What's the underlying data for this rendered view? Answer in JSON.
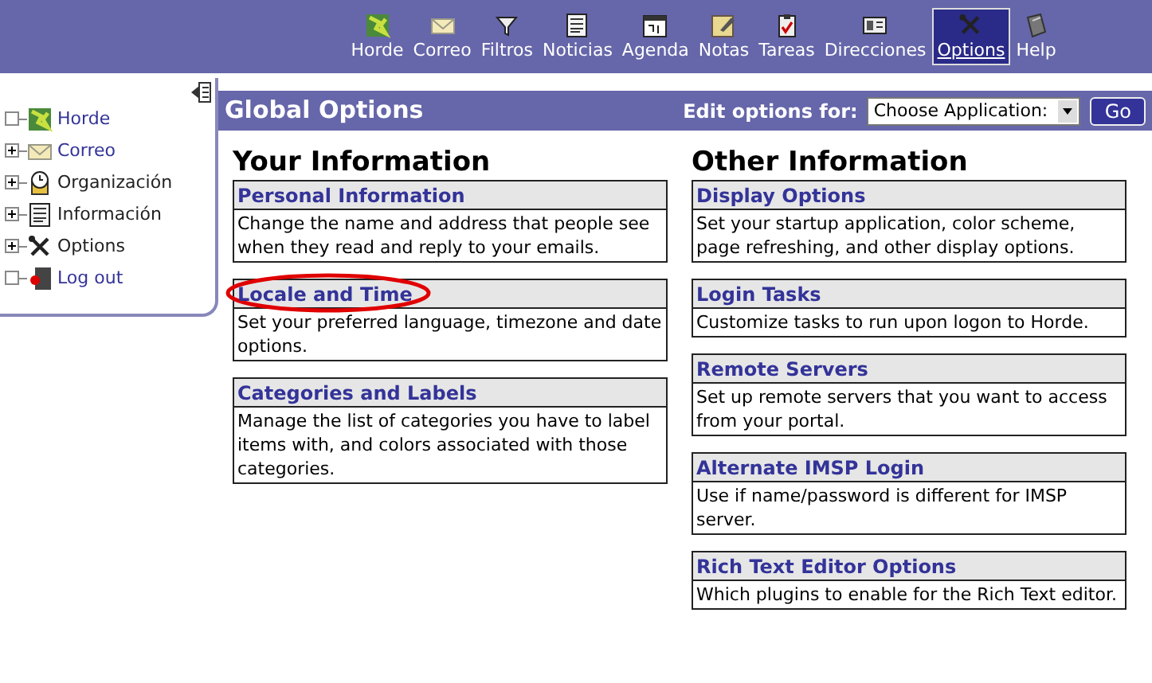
{
  "nav": [
    {
      "label": "Horde",
      "selected": false
    },
    {
      "label": "Correo",
      "selected": false
    },
    {
      "label": "Filtros",
      "selected": false
    },
    {
      "label": "Noticias",
      "selected": false
    },
    {
      "label": "Agenda",
      "selected": false
    },
    {
      "label": "Notas",
      "selected": false
    },
    {
      "label": "Tareas",
      "selected": false
    },
    {
      "label": "Direcciones",
      "selected": false
    },
    {
      "label": "Options",
      "selected": true
    },
    {
      "label": "Help",
      "selected": false
    }
  ],
  "sidebar": {
    "items": [
      {
        "label": "Horde",
        "expandable": false,
        "kind": "link"
      },
      {
        "label": "Correo",
        "expandable": true,
        "kind": "link"
      },
      {
        "label": "Organización",
        "expandable": true,
        "kind": "text"
      },
      {
        "label": "Información",
        "expandable": true,
        "kind": "text"
      },
      {
        "label": "Options",
        "expandable": true,
        "kind": "text"
      },
      {
        "label": "Log out",
        "expandable": false,
        "kind": "link"
      }
    ]
  },
  "title_bar": {
    "title": "Global Options",
    "select_label": "Edit options for:",
    "select_value": "Choose Application:",
    "button": "Go"
  },
  "columns": [
    {
      "heading": "Your Information",
      "sections": [
        {
          "title": "Personal Information",
          "description": "Change the name and address that people see when they read and reply to your emails.",
          "circled": false
        },
        {
          "title": "Locale and Time",
          "description": "Set your preferred language, timezone and date options.",
          "circled": true
        },
        {
          "title": "Categories and Labels",
          "description": "Manage the list of categories you have to label items with, and colors associated with those categories.",
          "circled": false
        }
      ]
    },
    {
      "heading": "Other Information",
      "sections": [
        {
          "title": "Display Options",
          "description": "Set your startup application, color scheme, page refreshing, and other display options.",
          "circled": false
        },
        {
          "title": "Login Tasks",
          "description": "Customize tasks to run upon logon to Horde.",
          "circled": false
        },
        {
          "title": "Remote Servers",
          "description": "Set up remote servers that you want to access from your portal.",
          "circled": false
        },
        {
          "title": "Alternate IMSP Login",
          "description": "Use if name/password is different for IMSP server.",
          "circled": false
        },
        {
          "title": "Rich Text Editor Options",
          "description": "Which plugins to enable for the Rich Text editor.",
          "circled": false
        }
      ]
    }
  ]
}
